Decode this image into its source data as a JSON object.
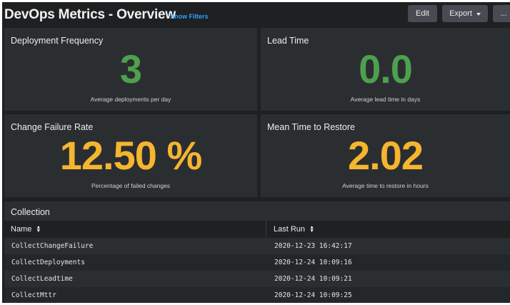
{
  "header": {
    "title": "DevOps Metrics - Overview",
    "show_filters": "Show Filters",
    "edit_label": "Edit",
    "export_label": "Export",
    "more_label": "..."
  },
  "colors": {
    "green": "#4da04d",
    "yellow": "#f5b52e",
    "link": "#2ea0ff"
  },
  "metrics": [
    {
      "title": "Deployment Frequency",
      "value": "3",
      "caption": "Average deployments per day",
      "color": "#4da04d"
    },
    {
      "title": "Lead Time",
      "value": "0.0",
      "caption": "Average lead time in days",
      "color": "#4da04d"
    },
    {
      "title": "Change Failure Rate",
      "value": "12.50 %",
      "caption": "Percentage of failed changes",
      "color": "#f5b52e"
    },
    {
      "title": "Mean Time to Restore",
      "value": "2.02",
      "caption": "Average time to restore in hours",
      "color": "#f5b52e"
    }
  ],
  "collection": {
    "title": "Collection",
    "columns": [
      "Name",
      "Last Run"
    ],
    "rows": [
      {
        "name": "CollectChangeFailure",
        "last_run": "2020-12-23 16:42:17"
      },
      {
        "name": "CollectDeployments",
        "last_run": "2020-12-24 10:09:16"
      },
      {
        "name": "CollectLeadtime",
        "last_run": "2020-12-24 10:09:21"
      },
      {
        "name": "CollectMttr",
        "last_run": "2020-12-24 10:09:25"
      }
    ]
  }
}
